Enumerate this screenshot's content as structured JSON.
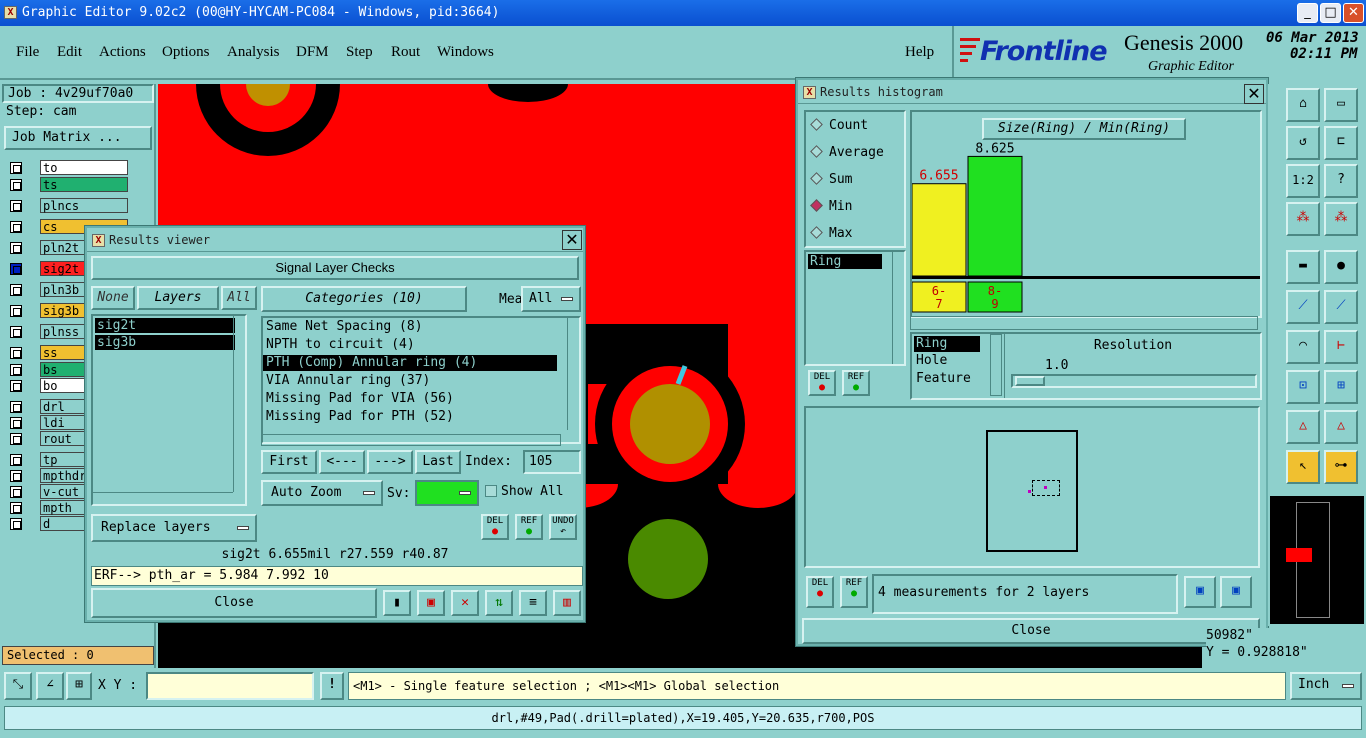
{
  "app": {
    "title": "Graphic Editor 9.02c2 (00@HY-HYCAM-PC084 - Windows, pid:3664)",
    "win_min": "_",
    "win_max": "□",
    "win_close": "✕"
  },
  "menu": {
    "items": [
      "File",
      "Edit",
      "Actions",
      "Options",
      "Analysis",
      "DFM",
      "Step",
      "Rout",
      "Windows"
    ],
    "help": "Help"
  },
  "logo": {
    "brand": "Frontline",
    "product": "Genesis 2000",
    "subtitle": "Graphic Editor",
    "date": "06 Mar 2013",
    "time": "02:11 PM"
  },
  "job": {
    "job": "Job : 4v29uf70a0",
    "step": "Step: cam",
    "matrix": "Job Matrix ..."
  },
  "layers": [
    {
      "name": "to",
      "color": "#ffffff"
    },
    {
      "name": "ts",
      "color": "#20b070"
    },
    {
      "name": "plncs",
      "color": "#8ed0cc"
    },
    {
      "name": "cs",
      "color": "#f0c030"
    },
    {
      "name": "pln2t",
      "color": "#8ed0cc"
    },
    {
      "name": "sig2t",
      "color": "#ff2020"
    },
    {
      "name": "pln3b",
      "color": "#8ed0cc"
    },
    {
      "name": "sig3b",
      "color": "#f0c030"
    },
    {
      "name": "plnss",
      "color": "#8ed0cc"
    },
    {
      "name": "ss",
      "color": "#f0c030"
    },
    {
      "name": "bs",
      "color": "#20b070"
    },
    {
      "name": "bo",
      "color": "#ffffff"
    },
    {
      "name": "drl",
      "color": "#8ed0cc"
    },
    {
      "name": "ldi",
      "color": "#8ed0cc"
    },
    {
      "name": "rout",
      "color": "#8ed0cc"
    },
    {
      "name": "tp",
      "color": "#8ed0cc"
    },
    {
      "name": "mpthdr",
      "color": "#8ed0cc"
    },
    {
      "name": "v-cut",
      "color": "#8ed0cc"
    },
    {
      "name": "mpth",
      "color": "#8ed0cc"
    },
    {
      "name": "d",
      "color": "#8ed0cc"
    }
  ],
  "selected": "Selected : 0",
  "viewer": {
    "title": "Results viewer",
    "header": "Signal Layer Checks",
    "none": "None",
    "layers_label": "Layers",
    "all": "All",
    "layer_list": [
      "sig2t",
      "sig3b"
    ],
    "categories_label": "Categories (10)",
    "meas_label": "Meas:",
    "meas_value": "All",
    "categories": [
      "Same Net Spacing (8)",
      "NPTH to circuit (4)",
      "PTH (Comp) Annular ring (4)",
      "VIA Annular ring (37)",
      "Missing Pad for VIA (56)",
      "Missing Pad for PTH (52)"
    ],
    "first": "First",
    "prev": "<---",
    "next": "--->",
    "last": "Last",
    "index_label": "Index:",
    "index_value": "105",
    "auto_zoom": "Auto Zoom",
    "sv_label": "Sv:",
    "show_all": "Show All",
    "replace_layers": "Replace layers",
    "del": "DEL",
    "ref": "REF",
    "undo": "UNDO",
    "info": "sig2t 6.655mil  r27.559  r40.87",
    "erf": "ERF--> pth_ar = 5.984 7.992 10",
    "close": "Close"
  },
  "histogram": {
    "title": "Results histogram",
    "modes": [
      "Count",
      "Average",
      "Sum",
      "Min",
      "Max"
    ],
    "active_mode": "Min",
    "list": [
      "Ring"
    ],
    "chart_title": "Size(Ring) / Min(Ring)",
    "props": [
      "Ring",
      "Hole",
      "Feature"
    ],
    "resolution_label": "Resolution",
    "resolution_value": "1.0",
    "del": "DEL",
    "ref": "REF",
    "summary": "4 measurements for 2 layers",
    "close": "Close"
  },
  "chart_data": {
    "type": "bar",
    "categories": [
      "6-7",
      "8-9"
    ],
    "values": [
      6.655,
      8.625
    ],
    "title": "Size(Ring) / Min(Ring)",
    "colors": [
      "#f0f020",
      "#20e020"
    ]
  },
  "coords": {
    "x": "50982\"",
    "y": "Y = 0.928818\""
  },
  "status": {
    "xy_label": "X Y :",
    "xy_value": "",
    "warn": "!",
    "message": "<M1> - Single feature selection ; <M1><M1> Global selection",
    "units": "Inch"
  },
  "bottom": "drl,#49,Pad(.drill=plated),X=19.405,Y=20.635,r700,POS"
}
